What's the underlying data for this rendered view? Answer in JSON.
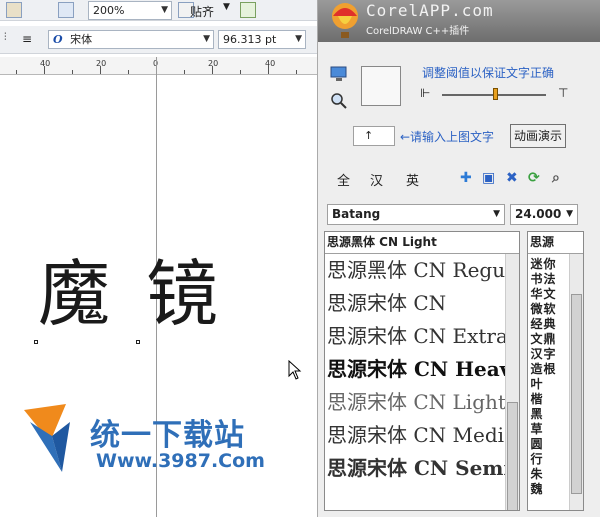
{
  "toolbar": {
    "zoom_value": "200%",
    "snap_label": "贴齐",
    "font_name": "宋体",
    "font_style_glyph": "O",
    "font_size": "96.313 pt"
  },
  "ruler": {
    "labels": [
      "40",
      "20",
      "0",
      "20",
      "40"
    ]
  },
  "canvas": {
    "char1": "魔",
    "char2": "镜"
  },
  "watermark": {
    "text": "统一下载站",
    "url": "Www.3987.Com"
  },
  "panel": {
    "title": "CorelAPP.com",
    "subtitle": "CorelDRAW C++插件",
    "hint_threshold": "调整阈值以保证文字正确",
    "char_input_value": "↑",
    "hint_input": "←请输入上图文字",
    "anim_button": "动画演示",
    "filters": [
      "全",
      "汉",
      "英"
    ],
    "font_select": "Batang",
    "size_select": "24.000",
    "font_list_header": "思源黑体 CN Light",
    "font_list": [
      "思源黑体 CN Regu",
      "思源宋体 CN",
      "思源宋体 CN Extra",
      "思源宋体 CN Heav",
      "思源宋体 CN Light",
      "思源宋体 CN Medi",
      "思源宋体 CN Semi"
    ],
    "char_list_header": "思源",
    "char_col_1": [
      "迷",
      "书",
      "华",
      "微",
      "经",
      "文",
      "汉",
      "造",
      "叶",
      "楷",
      "黑",
      "草",
      "圆",
      "行",
      "朱",
      "魏"
    ],
    "char_col_2": [
      "你",
      "法",
      "文",
      "软",
      "典",
      "鼎",
      "字",
      "根",
      "",
      "",
      "",
      "",
      "",
      "",
      "",
      ""
    ],
    "char_col_3": [
      "",
      "",
      "",
      "",
      "",
      "",
      "",
      "",
      "",
      "",
      "",
      "",
      "",
      "",
      "",
      ""
    ]
  },
  "colors": {
    "accent_blue": "#2c62c4",
    "watermark_blue": "#2f6fb8",
    "watermark_orange": "#f08a1c",
    "slider_thumb": "#e8a020"
  }
}
